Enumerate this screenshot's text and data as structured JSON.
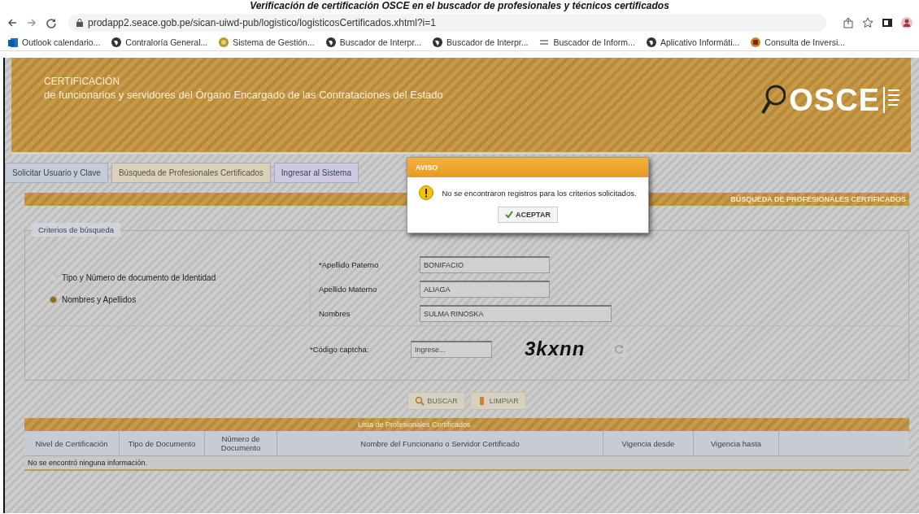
{
  "caption": "Verificación de certificación OSCE en el buscador de profesionales y técnicos certificados",
  "browser": {
    "url": "prodapp2.seace.gob.pe/sican-uiwd-pub/logistico/logisticosCertificados.xhtml?i=1",
    "bookmarks": [
      {
        "label": "Outlook calendario...",
        "kind": "outlook"
      },
      {
        "label": "Contraloría General...",
        "kind": "globe"
      },
      {
        "label": "Sistema de Gestión...",
        "kind": "coin"
      },
      {
        "label": "Buscador de Interpr...",
        "kind": "globe"
      },
      {
        "label": "Buscador de Interpr...",
        "kind": "globe"
      },
      {
        "label": "Buscador de Inform...",
        "kind": "lines"
      },
      {
        "label": "Aplicativo Informáti...",
        "kind": "globe"
      },
      {
        "label": "Consulta de Inversi...",
        "kind": "emblem"
      }
    ]
  },
  "header": {
    "title": "CERTIFICACIÓN",
    "subtitle": "de funcionarios y servidores del Órgano Encargado de las Contrataciones del Estado",
    "logo": "OSCE"
  },
  "tabs": [
    {
      "label": "Solicitar Usuario y Clave",
      "selected": false
    },
    {
      "label": "Búsqueda de Profesionales Certificados",
      "selected": true
    },
    {
      "label": "Ingresar al Sistema",
      "selected": false
    }
  ],
  "section_title": "BÚSQUEDA DE PROFESIONALES CERTIFICADOS",
  "criteria": {
    "legend": "Criterios de búsqueda",
    "options": [
      {
        "label": "Tipo y Número de documento de Identidad",
        "selected": false
      },
      {
        "label": "Nombres y Apellidos",
        "selected": true
      }
    ],
    "fields": [
      {
        "label": "*Apellido Paterno",
        "value": "BONIFACIO"
      },
      {
        "label": "Apellido Materno",
        "value": "ALIAGA"
      },
      {
        "label": "Nombres",
        "value": "SULMA RINOSKA"
      }
    ],
    "captcha": {
      "label": "*Código captcha:",
      "placeholder": "Ingrese...",
      "code": "3kxnn"
    }
  },
  "buttons": [
    {
      "label": "BUSCAR",
      "kind": "search"
    },
    {
      "label": "LIMPIAR",
      "kind": "clear"
    }
  ],
  "results": {
    "title": "Lista de Profesionales Certificados",
    "columns": [
      "Nivel de Certificación",
      "Tipo de Documento",
      "Número de Documento",
      "Nombre del Funcionario o Servidor Certificado",
      "Vigencia desde",
      "Vigencia hasta"
    ],
    "empty": "No se encontró ninguna información."
  },
  "dialog": {
    "title": "AVISO",
    "message": "No se encontraron registros para los criterios solicitados.",
    "button": "ACEPTAR"
  }
}
